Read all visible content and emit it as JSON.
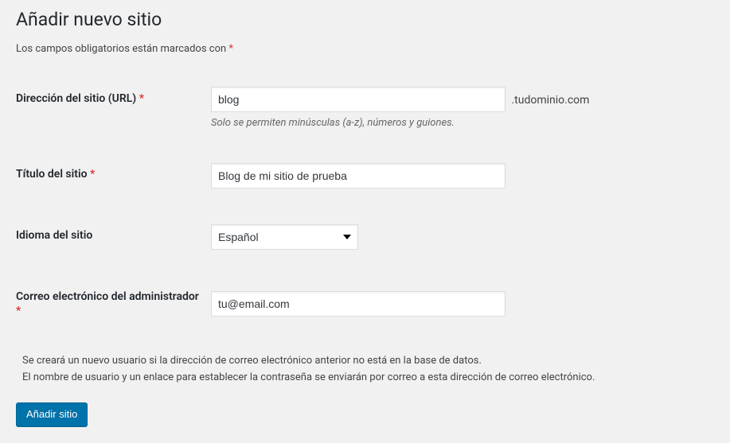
{
  "page_title": "Añadir nuevo sitio",
  "required_note": "Los campos obligatorios están marcados con ",
  "required_mark": "*",
  "fields": {
    "url": {
      "label": "Dirección del sitio (URL) ",
      "value": "blog",
      "suffix": ".tudominio.com",
      "description": "Solo se permiten minúsculas (a-z), números y guiones."
    },
    "title": {
      "label": "Título del sitio ",
      "value": "Blog de mi sitio de prueba"
    },
    "language": {
      "label": "Idioma del sitio",
      "selected": "Español"
    },
    "email": {
      "label": "Correo electrónico del administrador ",
      "value": "tu@email.com"
    }
  },
  "info": {
    "line1": "Se creará un nuevo usuario si la dirección de correo electrónico anterior no está en la base de datos.",
    "line2": "El nombre de usuario y un enlace para establecer la contraseña se enviarán por correo a esta dirección de correo electrónico."
  },
  "submit_label": "Añadir sitio"
}
